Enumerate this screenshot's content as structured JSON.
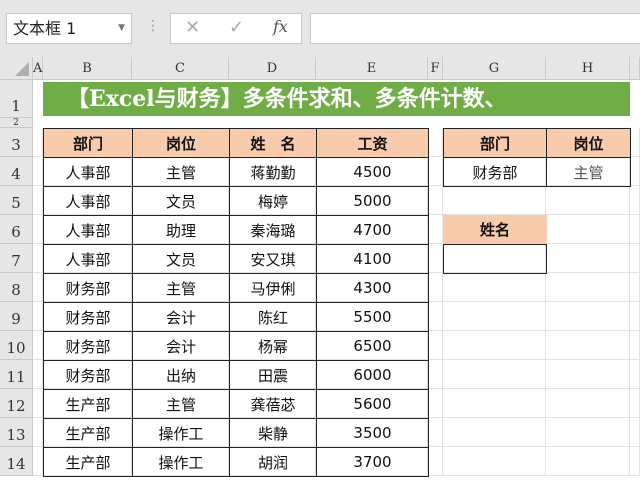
{
  "name_box": {
    "value": "文本框 1"
  },
  "formula_bar": {
    "cancel_icon": "✕",
    "enter_icon": "✓",
    "fx_label": "fx",
    "value": ""
  },
  "columns": [
    "A",
    "B",
    "C",
    "D",
    "E",
    "F",
    "G",
    "H"
  ],
  "rows": [
    "1",
    "2",
    "3",
    "4",
    "5",
    "6",
    "7",
    "8",
    "9",
    "10",
    "11",
    "12",
    "13",
    "14"
  ],
  "title": "【Excel与财务】多条件求和、多条件计数、",
  "table": {
    "headers": [
      "部门",
      "岗位",
      "姓　名",
      "工资"
    ],
    "rows": [
      [
        "人事部",
        "主管",
        "蒋勤勤",
        "4500"
      ],
      [
        "人事部",
        "文员",
        "梅婷",
        "5000"
      ],
      [
        "人事部",
        "助理",
        "秦海璐",
        "4700"
      ],
      [
        "人事部",
        "文员",
        "安又琪",
        "4100"
      ],
      [
        "财务部",
        "主管",
        "马伊俐",
        "4300"
      ],
      [
        "财务部",
        "会计",
        "陈红",
        "5500"
      ],
      [
        "财务部",
        "会计",
        "杨幂",
        "6500"
      ],
      [
        "财务部",
        "出纳",
        "田震",
        "6000"
      ],
      [
        "生产部",
        "主管",
        "龚蓓苾",
        "5600"
      ],
      [
        "生产部",
        "操作工",
        "柴静",
        "3500"
      ],
      [
        "生产部",
        "操作工",
        "胡润",
        "3700"
      ]
    ]
  },
  "criteria": {
    "headers": [
      "部门",
      "岗位"
    ],
    "values": [
      "财务部",
      "主管"
    ]
  },
  "result": {
    "header": "姓名",
    "value": ""
  },
  "colors": {
    "banner": "#70ad47",
    "header_fill": "#f8cbad"
  }
}
